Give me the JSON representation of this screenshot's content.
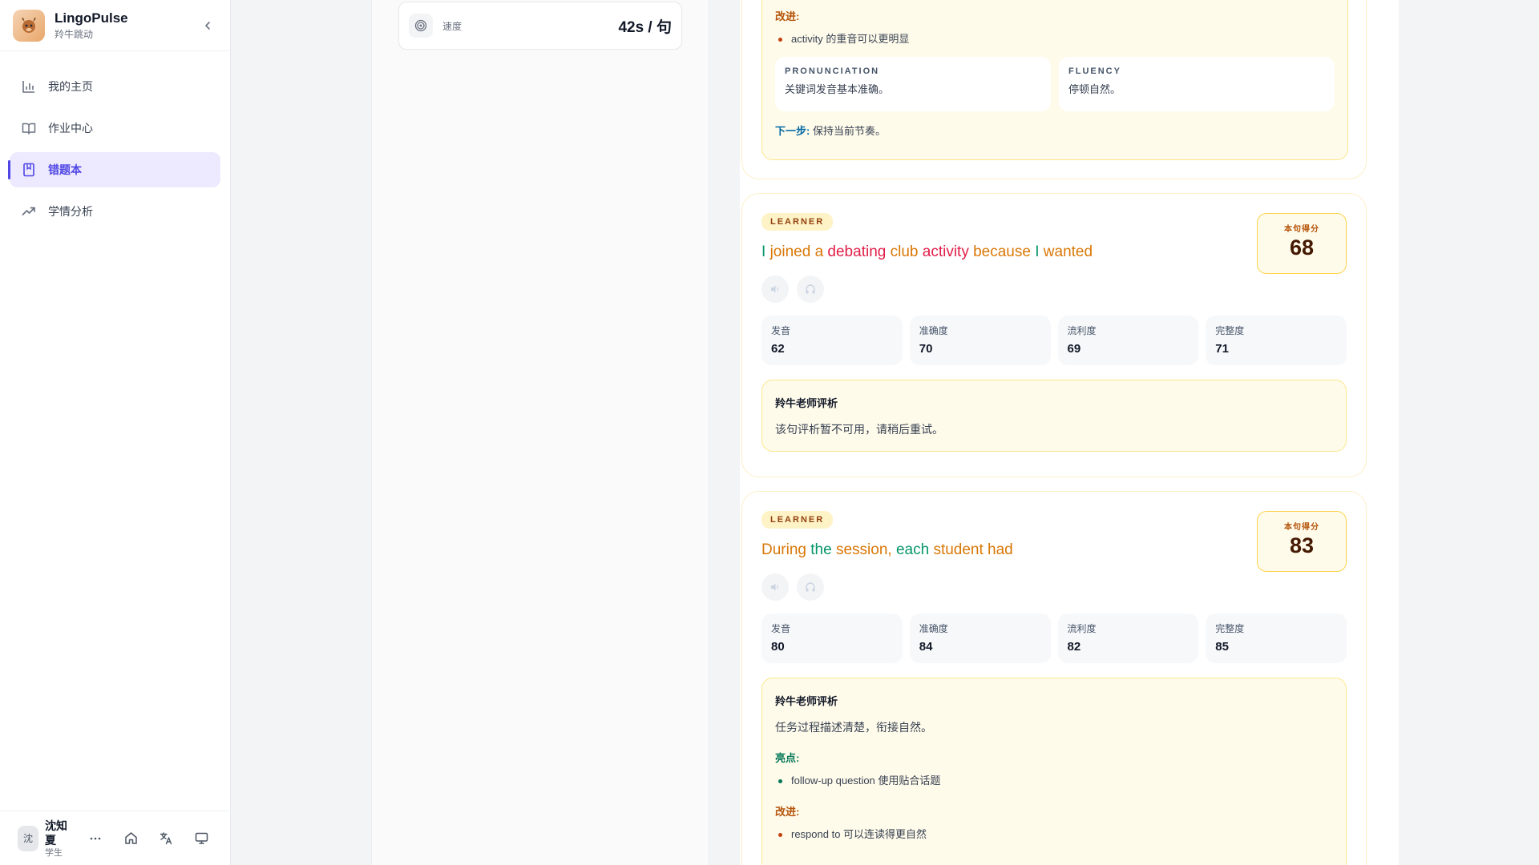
{
  "brand": {
    "name": "LingoPulse",
    "subtitle": "羚牛跳动"
  },
  "nav": {
    "items": [
      {
        "label": "我的主页",
        "icon": "bar-chart-icon"
      },
      {
        "label": "作业中心",
        "icon": "book-open-icon"
      },
      {
        "label": "错题本",
        "icon": "bookmark-book-icon",
        "active": true
      },
      {
        "label": "学情分析",
        "icon": "trending-up-icon"
      }
    ]
  },
  "user": {
    "avatar_text": "沈",
    "name": "沈知夏",
    "role": "学生",
    "more": "…"
  },
  "stat": {
    "label": "速度",
    "value": "42s / 句"
  },
  "card1": {
    "improve_title": "改进:",
    "improve_items": [
      "activity 的重音可以更明显"
    ],
    "pronunciation": {
      "heading": "PRONUNCIATION",
      "text": "关键词发音基本准确。"
    },
    "fluency": {
      "heading": "FLUENCY",
      "text": "停顿自然。"
    },
    "next_label": "下一步:",
    "next_text": "保持当前节奏。"
  },
  "card2": {
    "badge": "LEARNER",
    "sentence_words": [
      {
        "w": "I",
        "c": "g"
      },
      {
        "w": "joined",
        "c": "o"
      },
      {
        "w": "a",
        "c": "o"
      },
      {
        "w": "debating",
        "c": "r"
      },
      {
        "w": "club",
        "c": "o"
      },
      {
        "w": "activity",
        "c": "r"
      },
      {
        "w": "because",
        "c": "o"
      },
      {
        "w": "I",
        "c": "g"
      },
      {
        "w": "wanted",
        "c": "o"
      }
    ],
    "score_label": "本句得分",
    "score": "68",
    "metrics": [
      {
        "label": "发音",
        "value": "62"
      },
      {
        "label": "准确度",
        "value": "70"
      },
      {
        "label": "流利度",
        "value": "69"
      },
      {
        "label": "完整度",
        "value": "71"
      }
    ],
    "teacher_title": "羚牛老师评析",
    "teacher_text": "该句评析暂不可用，请稍后重试。"
  },
  "card3": {
    "badge": "LEARNER",
    "sentence_words": [
      {
        "w": "During",
        "c": "o"
      },
      {
        "w": "the",
        "c": "g"
      },
      {
        "w": "session,",
        "c": "o"
      },
      {
        "w": "each",
        "c": "g"
      },
      {
        "w": "student",
        "c": "o"
      },
      {
        "w": "had",
        "c": "o"
      }
    ],
    "score_label": "本句得分",
    "score": "83",
    "metrics": [
      {
        "label": "发音",
        "value": "80"
      },
      {
        "label": "准确度",
        "value": "84"
      },
      {
        "label": "流利度",
        "value": "82"
      },
      {
        "label": "完整度",
        "value": "85"
      }
    ],
    "teacher_title": "羚牛老师评析",
    "teacher_text": "任务过程描述清楚，衔接自然。",
    "highlight_title": "亮点:",
    "highlight_items": [
      "follow-up question 使用贴合话题"
    ],
    "improve_title": "改进:",
    "improve_items": [
      "respond to 可以连读得更自然"
    ]
  },
  "colors": {
    "accent": "#4f46e5",
    "accent_bg": "#ede9fe",
    "warm_bg": "#fffbeb",
    "warm_border": "#fde68a"
  }
}
